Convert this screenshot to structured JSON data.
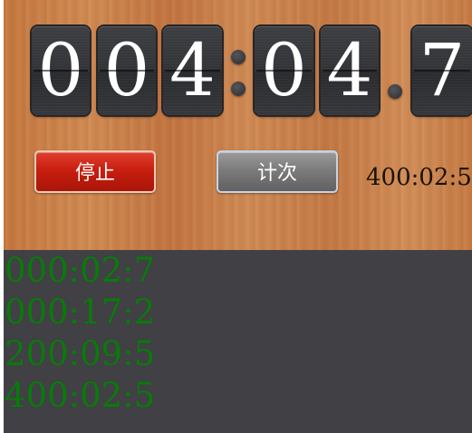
{
  "timer": {
    "digits": [
      "0",
      "0",
      "4",
      "0",
      "4",
      "7"
    ]
  },
  "buttons": {
    "stop_label": "停止",
    "lap_label": "计次"
  },
  "latest_lap": "400:02:5",
  "laps": [
    "000:02:7",
    "000:17:2",
    "200:09:5",
    "400:02:5"
  ],
  "colors": {
    "lap_text": "#0a7a0a",
    "panel_bg": "#404045",
    "stop_button": "#c81e10",
    "lap_button": "#7a7a7a"
  }
}
